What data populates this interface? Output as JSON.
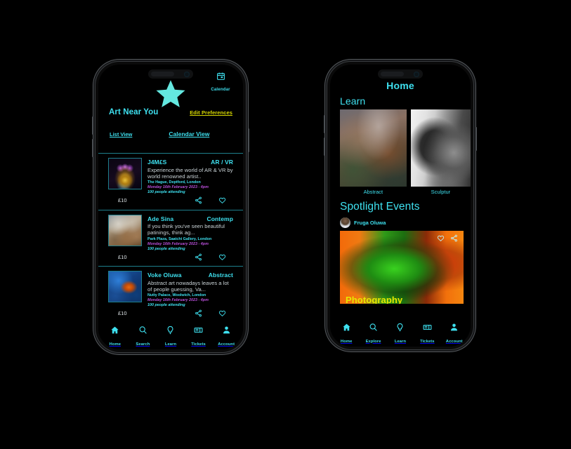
{
  "accent_colors": {
    "cyan": "#3ee0ef",
    "yellow": "#d8d800",
    "magenta": "#b84fd8",
    "background": "#000000"
  },
  "left_phone": {
    "logo_icon": "star-icon",
    "calendar_button": {
      "label": "Calendar",
      "icon": "calendar-icon"
    },
    "page_title": "Art Near You",
    "edit_preferences": "Edit Preferences",
    "view_tabs": [
      {
        "label": "List View",
        "selected": true
      },
      {
        "label": "Calendar View",
        "selected": false
      }
    ],
    "events": [
      {
        "artist": "J4M£S",
        "genre": "AR / VR",
        "description": "Experience the world of AR & VR by world renowned artist..",
        "venue": "The Hague, Deptford, London",
        "datetime": "Monday 16th February 2023 - 4pm",
        "attending": "100 people attending",
        "price": "£10",
        "share_icon": "share-icon",
        "favourite_icon": "heart-icon"
      },
      {
        "artist": "Ade Sina",
        "genre": "Contemp",
        "description": "If you think you've seen beautiful patinings, think ag...",
        "venue": "Park Plaza, Saatchi Gallery, London",
        "datetime": "Monday 16th February 2023 - 4pm",
        "attending": "100 people attending",
        "price": "£10",
        "share_icon": "share-icon",
        "favourite_icon": "heart-icon"
      },
      {
        "artist": "Voke Oluwa",
        "genre": "Abstract",
        "description": "Abstract art nowadays leaves a lot of people guessing, Va...",
        "venue": "Nutty Palace, Woolwich, London",
        "datetime": "Monday 16th February 2023 - 4pm",
        "attending": "100 people attending",
        "price": "£10",
        "share_icon": "share-icon",
        "favourite_icon": "heart-icon"
      }
    ],
    "tabbar": [
      {
        "label": "Home",
        "icon": "home-icon",
        "active": true
      },
      {
        "label": "Search",
        "icon": "search-icon",
        "active": false
      },
      {
        "label": "Learn",
        "icon": "lightbulb-icon",
        "active": false
      },
      {
        "label": "Tickets",
        "icon": "ticket-icon",
        "active": false
      },
      {
        "label": "Account",
        "icon": "person-icon",
        "active": false
      }
    ]
  },
  "right_phone": {
    "page_title": "Home",
    "learn_section": {
      "heading": "Learn",
      "cards": [
        {
          "caption": "Abstract"
        },
        {
          "caption": "Sculptur"
        }
      ]
    },
    "spotlight_section": {
      "heading": "Spotlight Events",
      "poster_name": "Fruga Oluwa",
      "poster_avatar": "avatar",
      "card_caption": "Photography",
      "favourite_icon": "heart-icon",
      "share_icon": "share-icon"
    },
    "tabbar": [
      {
        "label": "Home",
        "icon": "home-icon",
        "active": true
      },
      {
        "label": "Explore",
        "icon": "search-icon",
        "active": false
      },
      {
        "label": "Learn",
        "icon": "lightbulb-icon",
        "active": false
      },
      {
        "label": "Tickets",
        "icon": "ticket-icon",
        "active": false
      },
      {
        "label": "Account",
        "icon": "person-icon",
        "active": false
      }
    ]
  }
}
